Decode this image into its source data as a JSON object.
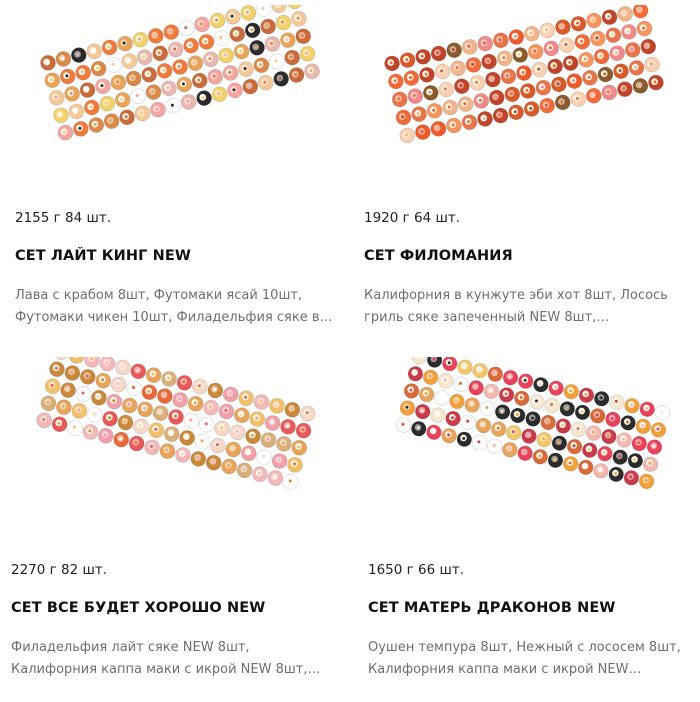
{
  "products": [
    {
      "weight_count": "2155 г 84 шт.",
      "title": "СЕТ ЛАЙТ КИНГ NEW",
      "description": "Лава с крабом 8шт, Футомаки ясай 10шт, Футомаки чикен 10шт, Филадельфия сяке в…",
      "image_icon": "sushi-platter-icon"
    },
    {
      "weight_count": "1920 г 64 шт.",
      "title": "СЕТ ФИЛОМАНИЯ",
      "description": "Калифорния в кунжуте эби хот 8шт, Лосось гриль сяке запеченный NEW 8шт,…",
      "image_icon": "sushi-platter-icon"
    },
    {
      "weight_count": "2270 г 82 шт.",
      "title": "СЕТ ВСЕ БУДЕТ ХОРОШО NEW",
      "description": "Филадельфия лайт сяке NEW 8шт, Калифорния каппа маки с икрой NEW 8шт,…",
      "image_icon": "sushi-platter-icon"
    },
    {
      "weight_count": "1650 г 66 шт.",
      "title": "СЕТ МАТЕРЬ ДРАКОНОВ NEW",
      "description": "Оушен темпура 8шт, Нежный с лососем 8шт, Калифорния каппа маки с икрой NEW…",
      "image_icon": "sushi-platter-icon"
    }
  ],
  "colors": {
    "title": "#111111",
    "meta": "#222222",
    "description": "#6e6e6e",
    "background": "#ffffff"
  }
}
